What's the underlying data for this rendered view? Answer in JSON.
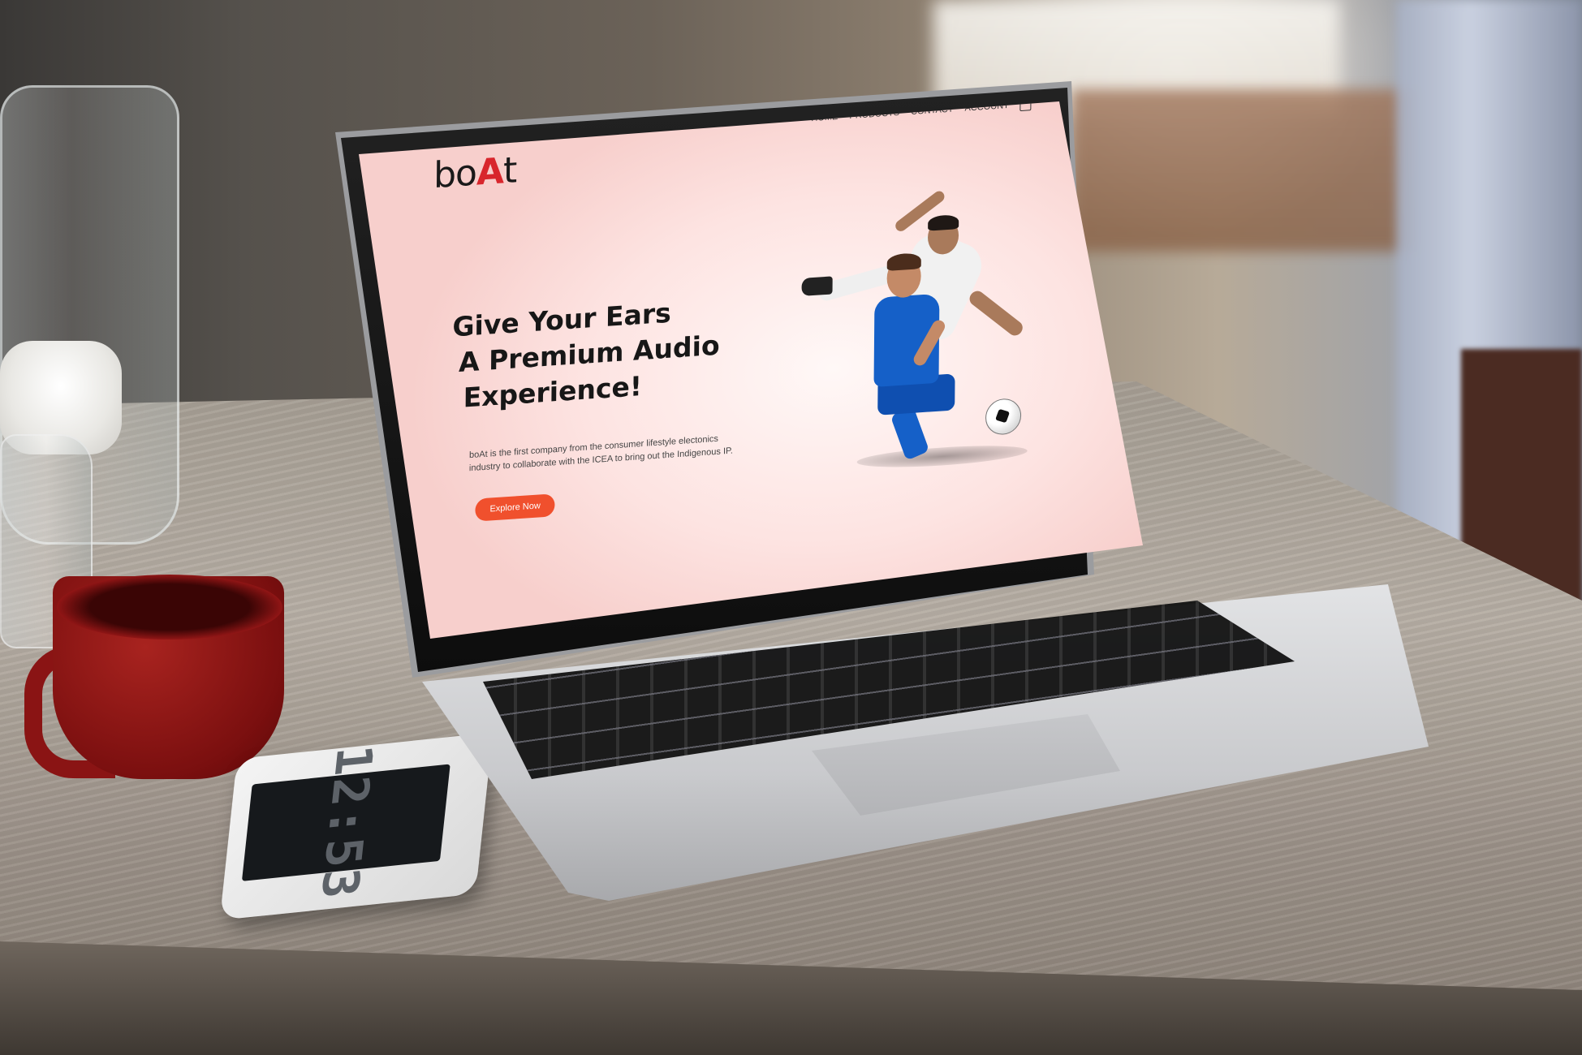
{
  "site": {
    "logo_text": {
      "prefix": "bo",
      "accent": "A",
      "suffix": "t"
    },
    "nav": [
      {
        "label": "HOME"
      },
      {
        "label": "PRODUCTS"
      },
      {
        "label": "CONTACT"
      },
      {
        "label": "ACCOUNT"
      }
    ],
    "cart_icon": "shopping-bag-icon",
    "hero": {
      "headline_lines": [
        "Give Your Ears",
        "A Premium Audio",
        "Experience!"
      ],
      "description": "boAt is the first company from the consumer lifestyle electonics industry to collaborate with the ICEA to bring out the Indigenous IP.",
      "cta_label": "Explore Now",
      "image": "footballers-illustration"
    },
    "colors": {
      "accent": "#f0502d",
      "logo_red": "#d8262c",
      "background": "#fde3e1"
    }
  },
  "phone": {
    "clock": "12:53"
  }
}
